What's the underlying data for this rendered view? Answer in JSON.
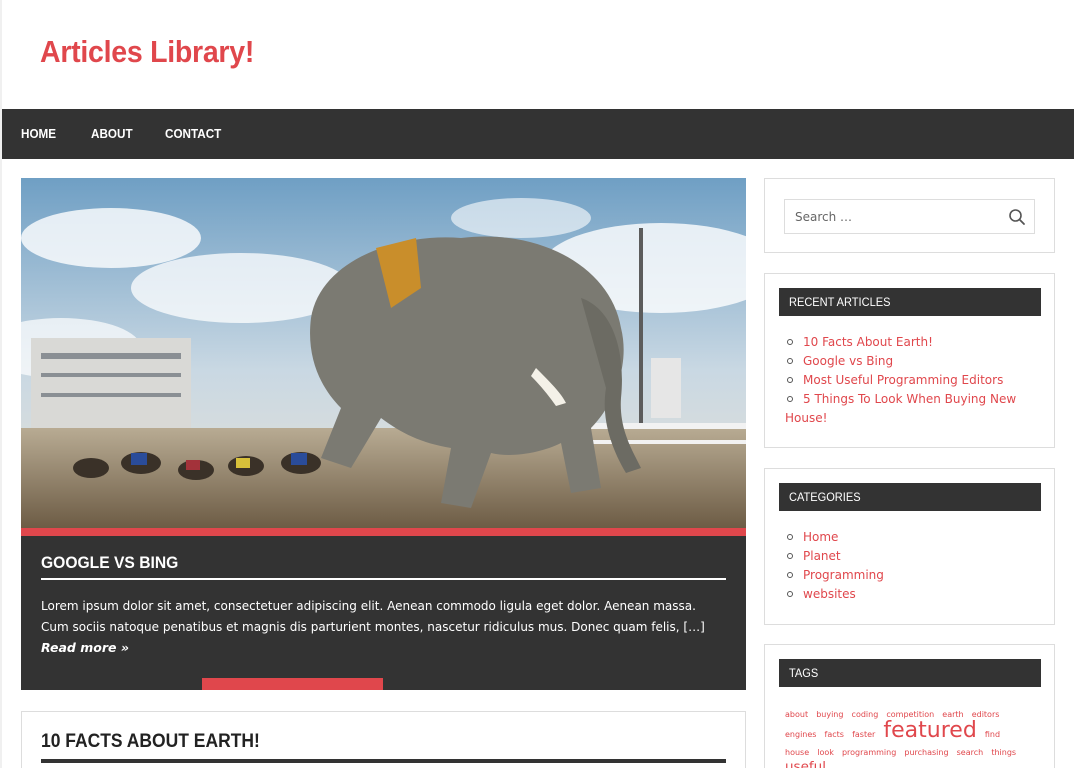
{
  "site": {
    "title": "Articles Library!"
  },
  "nav": {
    "items": [
      "HOME",
      "ABOUT",
      "CONTACT"
    ]
  },
  "featured": {
    "title": "GOOGLE VS BING",
    "excerpt": "Lorem ipsum dolor sit amet, consectetuer adipiscing elit. Aenean commodo ligula eget dolor. Aenean massa. Cum sociis natoque penatibus et magnis dis parturient montes, nascetur ridiculus mus. Donec quam felis, […]",
    "read_more": "Read more »"
  },
  "post": {
    "title": "10 FACTS ABOUT EARTH!"
  },
  "search": {
    "placeholder": "Search …",
    "icon": "search-icon"
  },
  "recent": {
    "title": "RECENT ARTICLES",
    "items": [
      "10 Facts About Earth!",
      "Google vs Bing",
      "Most Useful Programming Editors",
      "5 Things To Look When Buying New House!"
    ]
  },
  "categories": {
    "title": "CATEGORIES",
    "items": [
      "Home",
      "Planet",
      "Programming",
      "websites"
    ]
  },
  "tags": {
    "title": "TAGS",
    "items": [
      "about",
      "buying",
      "coding",
      "competition",
      "earth",
      "editors",
      "engines",
      "facts",
      "faster",
      "featured",
      "find",
      "house",
      "look",
      "programming",
      "purchasing",
      "search",
      "things",
      "useful"
    ]
  },
  "colors": {
    "accent": "#e0474c",
    "dark": "#333333"
  }
}
